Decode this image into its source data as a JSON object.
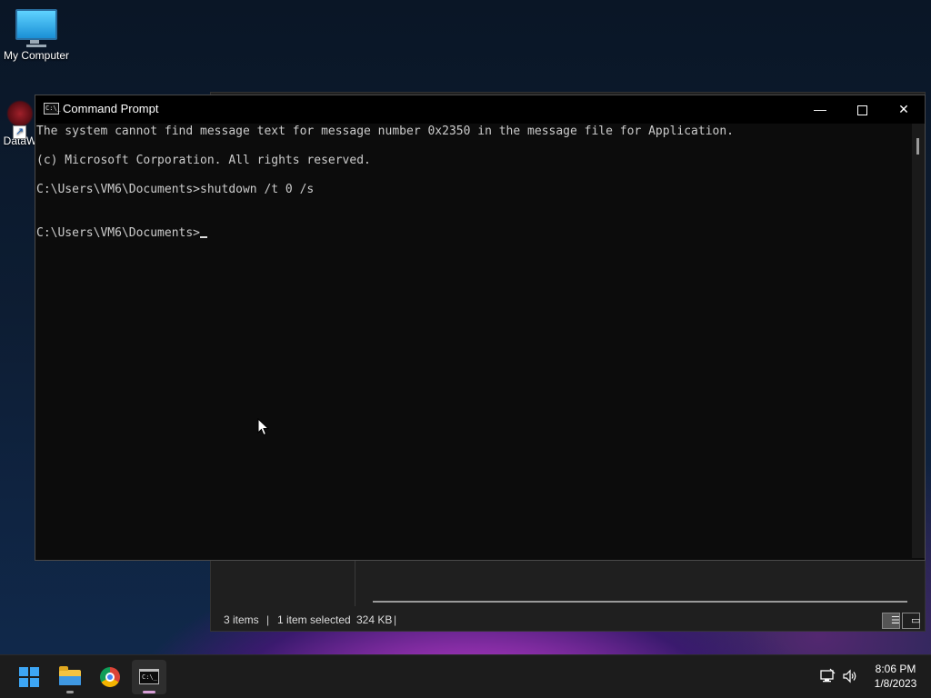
{
  "desktop": {
    "icons": [
      {
        "label": "My Computer"
      },
      {
        "label": "DataW"
      }
    ]
  },
  "explorer": {
    "status": {
      "items": "3 items",
      "selected": "1 item selected",
      "size": "324 KB",
      "separator": "|"
    }
  },
  "cmd": {
    "title": "Command Prompt",
    "icon_text": "C:\\_",
    "lines": [
      "The system cannot find message text for message number 0x2350 in the message file for Application.",
      "(c) Microsoft Corporation. All rights reserved.",
      "C:\\Users\\VM6\\Documents>shutdown /t 0 /s",
      "C:\\Users\\VM6\\Documents>"
    ],
    "controls": {
      "minimize": "—",
      "close": "✕"
    }
  },
  "taskbar": {
    "apps": [
      "start",
      "file-explorer",
      "google-chrome",
      "command-prompt"
    ],
    "clock": {
      "time": "8:06 PM",
      "date": "1/8/2023"
    }
  },
  "colors": {
    "console_bg": "#0c0c0c",
    "console_text": "#cccccc",
    "taskbar_bg": "#1c1c1c",
    "start_blue": "#3da6f5"
  }
}
